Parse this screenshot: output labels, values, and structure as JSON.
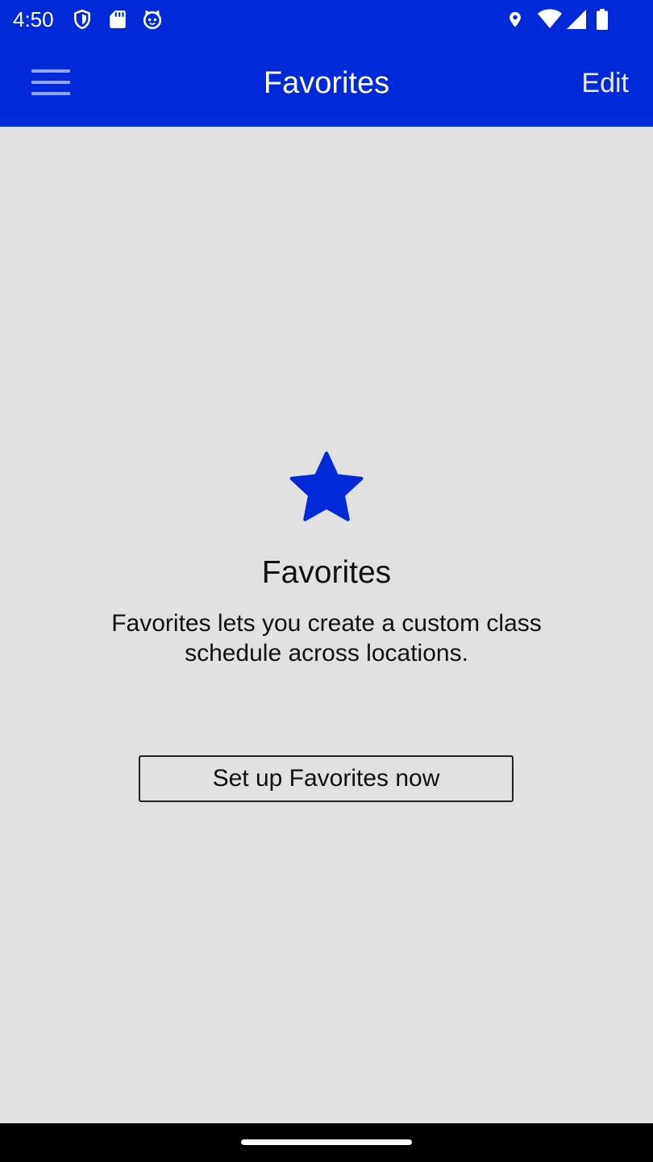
{
  "status_bar": {
    "time": "4:50",
    "left_icons": [
      "shield-icon",
      "sd-card-icon",
      "cat-face-icon"
    ],
    "right_icons": [
      "location-icon",
      "wifi-icon",
      "signal-icon",
      "battery-icon"
    ]
  },
  "app_bar": {
    "menu_icon": "hamburger-menu-icon",
    "title": "Favorites",
    "edit_label": "Edit"
  },
  "empty_state": {
    "icon": "star-icon",
    "title": "Favorites",
    "description": "Favorites lets you create a custom class schedule across locations.",
    "button_label": "Set up Favorites now"
  },
  "colors": {
    "primary": "#0029d7",
    "background": "#e1e1e1",
    "menu_icon": "#8ea6ff",
    "text": "#111111",
    "nav_bar": "#000000"
  }
}
